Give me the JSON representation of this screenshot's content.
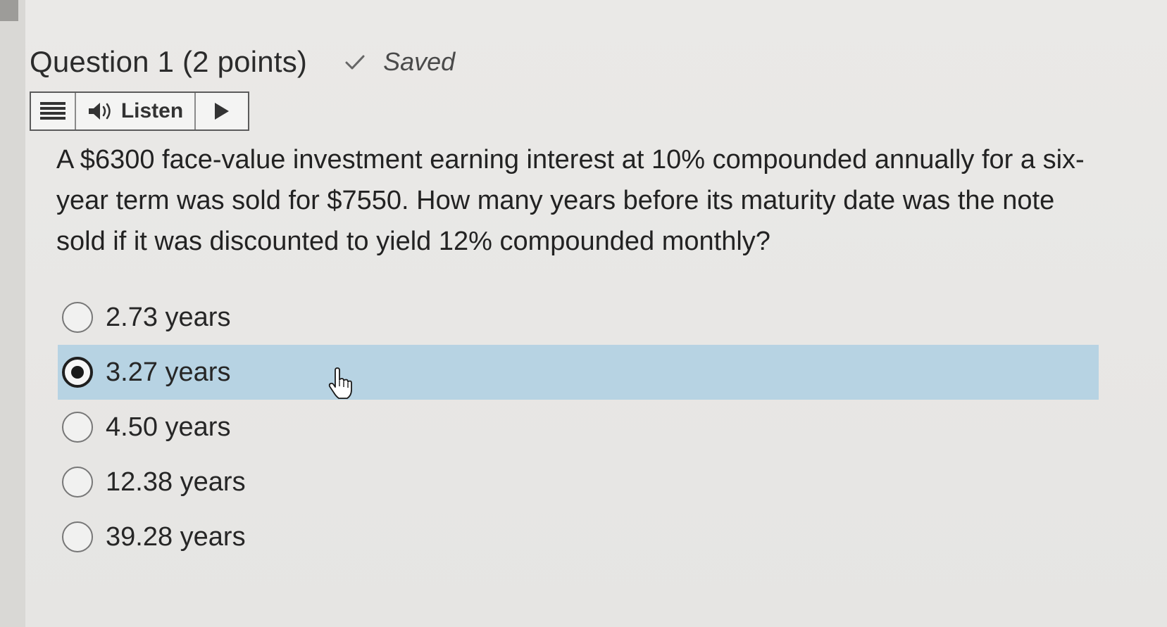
{
  "question": {
    "title": "Question 1 (2 points)",
    "status": "Saved",
    "text": "A $6300 face-value investment earning interest at 10% compounded annually for a six-year term was sold for $7550. How many years before its maturity date was the note sold if it was discounted to yield 12% compounded monthly?"
  },
  "listen_bar": {
    "menu_icon": "hamburger-menu-icon",
    "speaker_icon": "speaker-icon",
    "listen_label": "Listen",
    "play_icon": "play-icon"
  },
  "options": [
    {
      "label": "2.73 years",
      "selected": false
    },
    {
      "label": "3.27 years",
      "selected": true
    },
    {
      "label": "4.50 years",
      "selected": false
    },
    {
      "label": "12.38 years",
      "selected": false
    },
    {
      "label": "39.28 years",
      "selected": false
    }
  ],
  "colors": {
    "selected_row": "#b7d3e3",
    "page_background": "#e6e5e3"
  },
  "cursor": "hand-pointer-icon"
}
